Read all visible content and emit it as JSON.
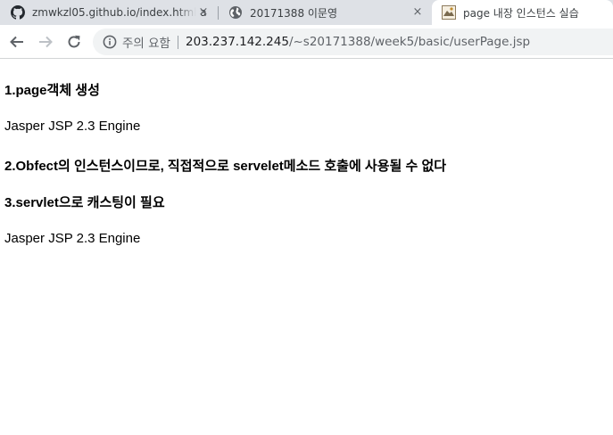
{
  "browser": {
    "tabs": [
      {
        "title": "zmwkzl05.github.io/index.html a",
        "icon": "github-icon",
        "close": "×"
      },
      {
        "title": "20171388 이문영",
        "icon": "globe-icon",
        "close": "×"
      },
      {
        "title": "page 내장 인스턴스 실습",
        "icon": "page-thumbnail-icon"
      }
    ],
    "address_bar": {
      "security_label": "주의 요함",
      "url_host": "203.237.142.245",
      "url_path": "/~s20171388/week5/basic/userPage.jsp"
    }
  },
  "page": {
    "heading1": "1.page객체 생성",
    "text1": "Jasper JSP 2.3 Engine",
    "heading2": "2.Obfect의 인스턴스이므로, 직접적으로 servelet메소드 호출에 사용될 수 없다",
    "heading3": "3.servlet으로 캐스팅이 필요",
    "text2": "Jasper JSP 2.3 Engine"
  }
}
